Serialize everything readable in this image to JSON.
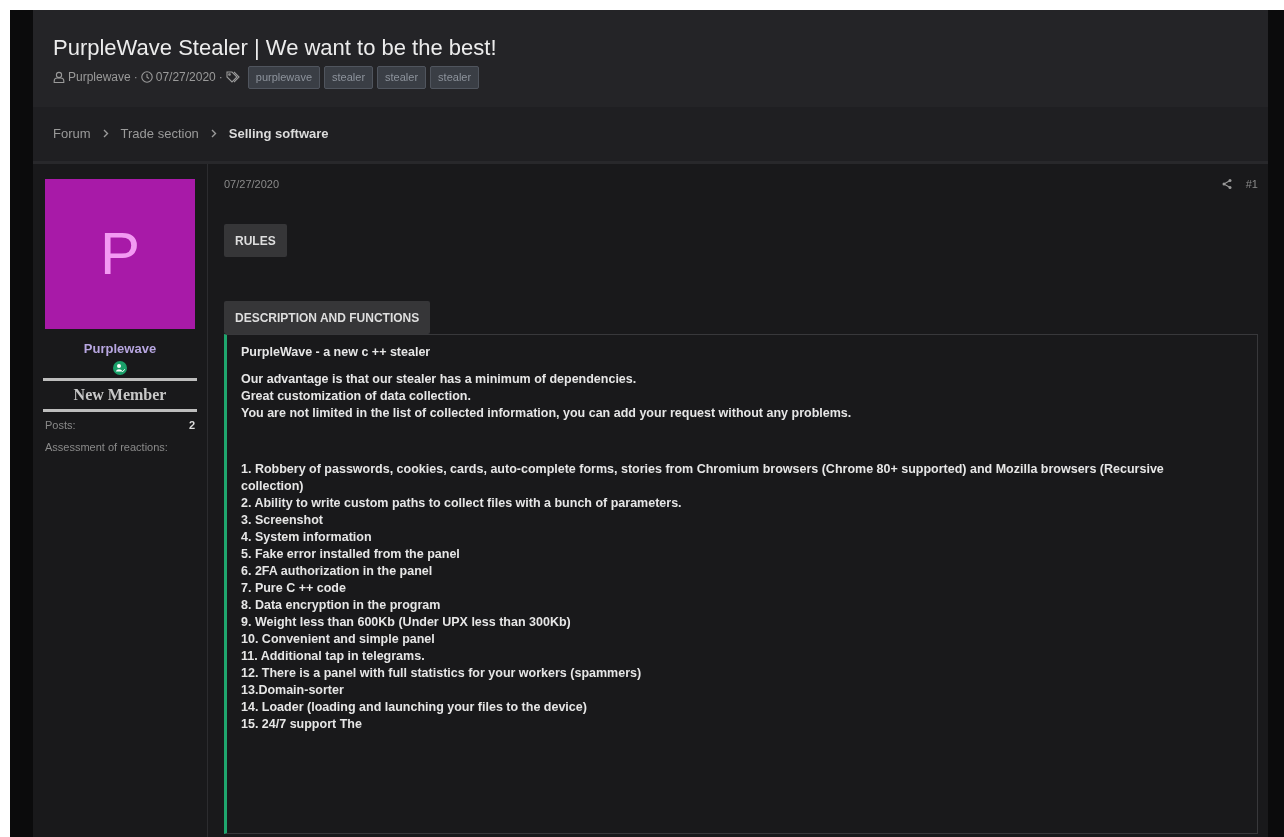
{
  "thread": {
    "title": "PurpleWave Stealer | We want to be the best!",
    "author": "Purplewave",
    "date": "07/27/2020",
    "separators": [
      "·",
      "·"
    ],
    "tags": [
      "purplewave",
      "stealer",
      "stealer",
      "stealer"
    ]
  },
  "breadcrumbs": [
    {
      "label": "Forum",
      "selected": false
    },
    {
      "label": "Trade section",
      "selected": false
    },
    {
      "label": "Selling software",
      "selected": true
    }
  ],
  "user": {
    "avatar_letter": "P",
    "name": "Purplewave",
    "role": "New Member",
    "stats": [
      {
        "label": "Posts:",
        "value": "2"
      },
      {
        "label": "Assessment of reactions:"
      }
    ]
  },
  "post": {
    "date": "07/27/2020",
    "number": "#1",
    "spoilers": [
      {
        "label": "RULES"
      },
      {
        "label": "DESCRIPTION AND FUNCTIONS",
        "paragraphs": [
          [
            "PurpleWave - a new c ++ stealer"
          ],
          [
            "Our advantage is that our stealer has a minimum of dependencies.",
            "Great customization of data collection.",
            "You are not limited in the list of collected information, you can add your request without any problems."
          ],
          [
            "1. Robbery of passwords, cookies, cards, auto-complete forms, stories from Chromium browsers (Chrome 80+ supported) and Mozilla browsers (Recursive collection)",
            "2. Ability to write custom paths to collect files with a bunch of parameters.",
            "3. Screenshot",
            "4. System information",
            "5. Fake error installed from the panel",
            "6. 2FA authorization in the panel",
            "7. Pure C ++ code",
            "8. Data encryption in the program",
            "9. Weight less than 600Kb (Under UPX less than 300Kb)",
            "10. Convenient and simple panel",
            "11. Additional tap in telegrams.",
            "12. There is a panel with full statistics for your workers (spammers)",
            "13.Domain-sorter",
            "14. Loader (loading and launching your files to the device)",
            "15. 24/7 support The"
          ]
        ]
      }
    ]
  }
}
